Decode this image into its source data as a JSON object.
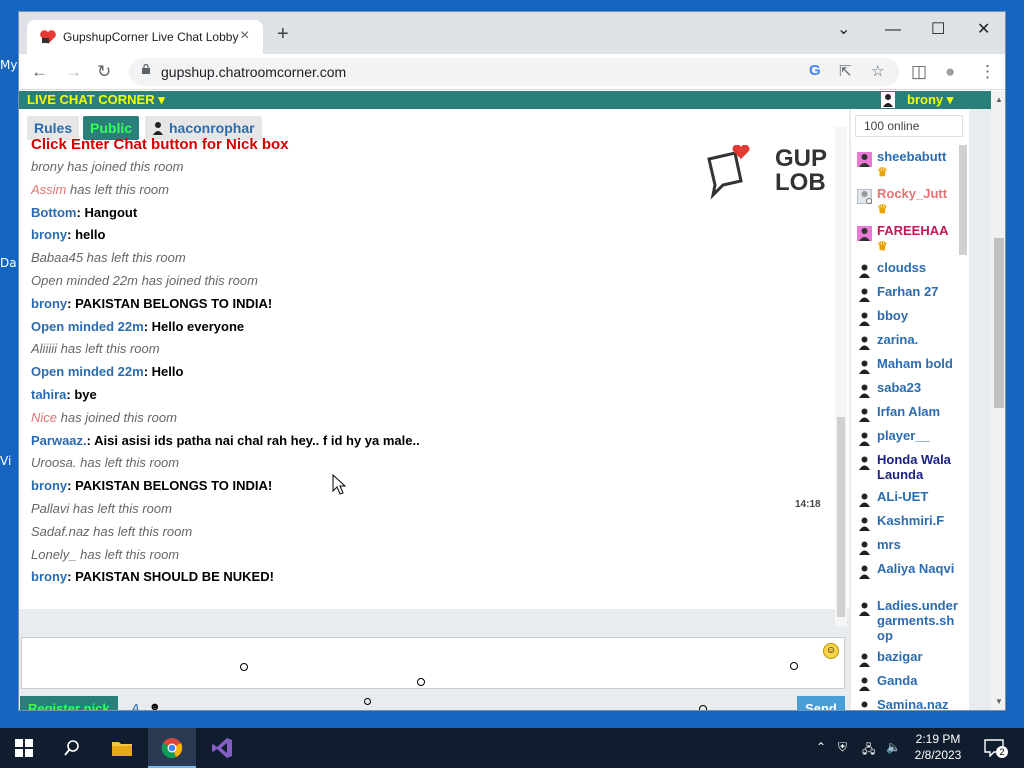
{
  "desktop": {
    "labels": [
      "My",
      "Da",
      "Vi"
    ]
  },
  "browser": {
    "tab_title": "GupshupCorner Live Chat Lobby",
    "tab_close": "×",
    "new_tab": "+",
    "url": "gupshup.chatroomcorner.com",
    "controls": {
      "chevron": "⌄",
      "minimize": "—",
      "maximize": "☐",
      "close": "✕"
    },
    "nav": {
      "back": "←",
      "forward": "→",
      "reload": "↻",
      "google": "G",
      "share": "⇱",
      "star": "☆",
      "sidebar": "◫",
      "profile": "●",
      "menu": "⋮"
    }
  },
  "chat": {
    "brand": "LIVE CHAT CORNER ▾",
    "current_user": "brony ▾",
    "buttons": {
      "rules": "Rules",
      "public": "Public",
      "private_user": "haconrophar"
    },
    "logo_text": "GUP LOB",
    "notice": "Click Enter Chat button for Nick box",
    "messages": [
      {
        "nick": "",
        "text": "brony has joined this room",
        "kind": "sys"
      },
      {
        "nick": "Assim",
        "text": " has left this room",
        "kind": "syspink"
      },
      {
        "nick": "Bottom",
        "text": ": Hangout",
        "kind": "msg"
      },
      {
        "nick": "brony",
        "text": ": hello",
        "kind": "msg"
      },
      {
        "nick": "",
        "text": "Babaa45 has left this room",
        "kind": "sys"
      },
      {
        "nick": "",
        "text": "Open minded 22m has joined this room",
        "kind": "sys"
      },
      {
        "nick": "brony",
        "text": ": PAKISTAN BELONGS TO INDIA!",
        "kind": "msg"
      },
      {
        "nick": "Open minded 22m",
        "text": ": Hello everyone",
        "kind": "msg"
      },
      {
        "nick": "",
        "text": "Aliiiii has left this room",
        "kind": "sys"
      },
      {
        "nick": "Open minded 22m",
        "text": ": Hello",
        "kind": "msg"
      },
      {
        "nick": "tahira",
        "text": ": bye",
        "kind": "msg"
      },
      {
        "nick": "Nice",
        "text": " has joined this room",
        "kind": "syspink"
      },
      {
        "nick": "Parwaaz.",
        "text": ": Aisi asisi ids patha nai chal rah hey.. f id hy ya male..",
        "kind": "msg"
      },
      {
        "nick": "",
        "text": "Uroosa. has left this room",
        "kind": "sys"
      },
      {
        "nick": "brony",
        "text": ": PAKISTAN BELONGS TO INDIA!",
        "kind": "msg"
      },
      {
        "nick": "",
        "text": "Pallavi has left this room",
        "kind": "sys"
      },
      {
        "nick": "",
        "text": "Sadaf.naz has left this room",
        "kind": "sys"
      },
      {
        "nick": "",
        "text": "Lonely_ has left this room",
        "kind": "sys"
      },
      {
        "nick": "brony",
        "text": ": PAKISTAN SHOULD BE NUKED!",
        "kind": "msg"
      }
    ],
    "timestamp": "14:18",
    "register_label": "Register nick",
    "format_label": "A",
    "send_label": "Send",
    "online_placeholder": "100 online"
  },
  "users": [
    {
      "name": "sheebabutt",
      "color": "#2b6cb0",
      "crown": true,
      "icon": "female-icon"
    },
    {
      "name": "Rocky_Jutt",
      "color": "#e57373",
      "crown": true,
      "icon": "avatar-icon"
    },
    {
      "name": "FAREEHAA",
      "color": "#c2185b",
      "crown": true,
      "icon": "female-icon"
    },
    {
      "name": "cloudss",
      "color": "#2b6cb0",
      "crown": false,
      "icon": "male-icon"
    },
    {
      "name": "Farhan 27",
      "color": "#2b6cb0",
      "crown": false,
      "icon": "male-icon"
    },
    {
      "name": "bboy",
      "color": "#2b6cb0",
      "crown": false,
      "icon": "male-icon"
    },
    {
      "name": "zarina.",
      "color": "#2b6cb0",
      "crown": false,
      "icon": "male-icon"
    },
    {
      "name": "Maham bold",
      "color": "#2b6cb0",
      "crown": false,
      "icon": "male-icon"
    },
    {
      "name": "saba23",
      "color": "#2b6cb0",
      "crown": false,
      "icon": "male-icon"
    },
    {
      "name": "Irfan Alam",
      "color": "#2b6cb0",
      "crown": false,
      "icon": "male-icon"
    },
    {
      "name": "player__",
      "color": "#2b6cb0",
      "crown": false,
      "icon": "male-icon"
    },
    {
      "name": "Honda Wala Launda",
      "color": "#1a237e",
      "crown": false,
      "icon": "male-icon"
    },
    {
      "name": "ALi-UET",
      "color": "#2b6cb0",
      "crown": false,
      "icon": "male-icon"
    },
    {
      "name": "Kashmiri.F",
      "color": "#2b6cb0",
      "crown": false,
      "icon": "male-icon"
    },
    {
      "name": "mrs",
      "color": "#2b6cb0",
      "crown": false,
      "icon": "male-icon"
    },
    {
      "name": "Aaliya Naqvi",
      "color": "#2b6cb0",
      "crown": false,
      "icon": "male-icon"
    },
    {
      "name": "Ladies.undergarments.shop",
      "color": "#2b6cb0",
      "crown": false,
      "icon": "male-icon"
    },
    {
      "name": "bazigar",
      "color": "#2b6cb0",
      "crown": false,
      "icon": "male-icon"
    },
    {
      "name": "Ganda",
      "color": "#2b6cb0",
      "crown": false,
      "icon": "male-icon"
    },
    {
      "name": "Samina.naz",
      "color": "#2b6cb0",
      "crown": false,
      "icon": "male-icon"
    }
  ],
  "taskbar": {
    "time": "2:19 PM",
    "date": "2/8/2023",
    "notifications": "2"
  },
  "colors": {
    "teal": "#2b7f7b",
    "yellow": "#f3ff00",
    "nick_blue": "#2b6cb0",
    "red": "#d40000",
    "send_blue": "#4a9ed8"
  }
}
